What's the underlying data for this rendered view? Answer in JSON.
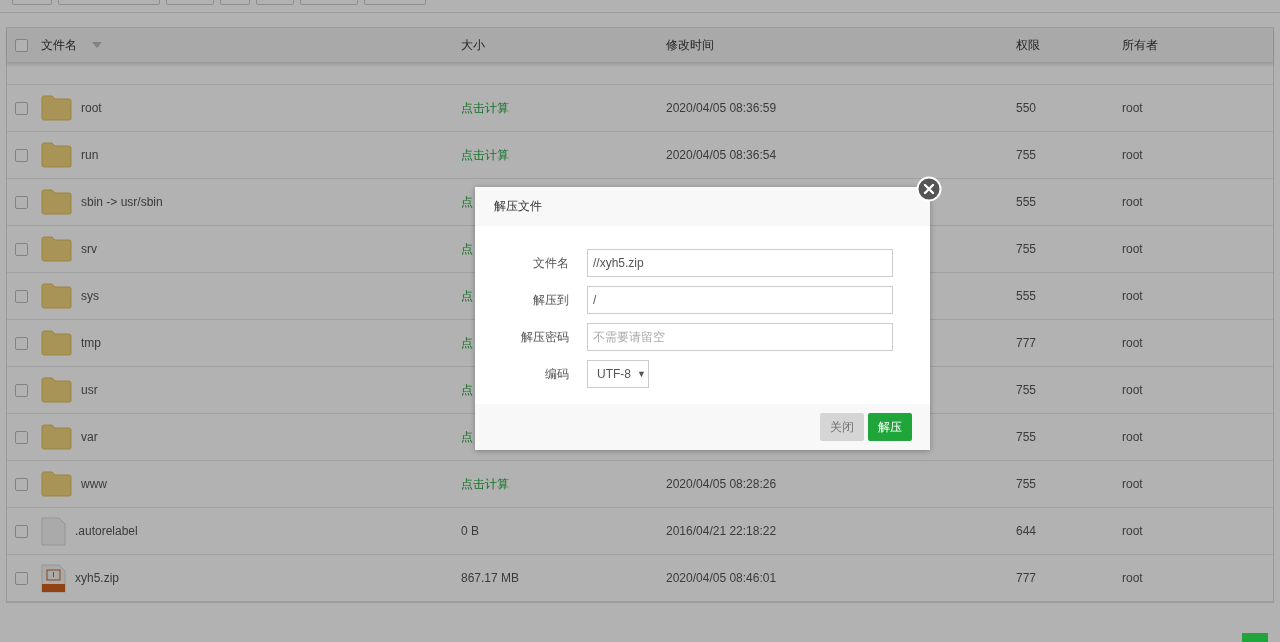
{
  "table": {
    "header_checkbox": {
      "checked": false
    },
    "columns": [
      {
        "label": "文件名",
        "sortable": true
      },
      {
        "label": "大小"
      },
      {
        "label": "修改时间"
      },
      {
        "label": "权限"
      },
      {
        "label": "所有者"
      }
    ],
    "rows": [
      {
        "kind": "folder",
        "checked": false,
        "name": "root",
        "size": "点击计算",
        "size_link": true,
        "time": "2020/04/05 08:36:59",
        "perm": "550",
        "owner": "root"
      },
      {
        "kind": "folder",
        "checked": false,
        "name": "run",
        "size": "点击计算",
        "size_link": true,
        "time": "2020/04/05 08:36:54",
        "perm": "755",
        "owner": "root"
      },
      {
        "kind": "folder",
        "checked": false,
        "name": "sbin -> usr/sbin",
        "size": "点",
        "size_link": true,
        "perm": "555",
        "owner": "root"
      },
      {
        "kind": "folder",
        "checked": false,
        "name": "srv",
        "size": "点",
        "size_link": true,
        "perm": "755",
        "owner": "root"
      },
      {
        "kind": "folder",
        "checked": false,
        "name": "sys",
        "size": "点",
        "size_link": true,
        "perm": "555",
        "owner": "root"
      },
      {
        "kind": "folder",
        "checked": false,
        "name": "tmp",
        "size": "点",
        "size_link": true,
        "perm": "777",
        "owner": "root"
      },
      {
        "kind": "folder",
        "checked": false,
        "name": "usr",
        "size": "点",
        "size_link": true,
        "perm": "755",
        "owner": "root"
      },
      {
        "kind": "folder",
        "checked": false,
        "name": "var",
        "size": "点",
        "size_link": true,
        "perm": "755",
        "owner": "root"
      },
      {
        "kind": "folder",
        "checked": false,
        "name": "www",
        "size": "点击计算",
        "size_link": true,
        "time": "2020/04/05 08:28:26",
        "perm": "755",
        "owner": "root"
      },
      {
        "kind": "file",
        "checked": false,
        "name": ".autorelabel",
        "size": "0 B",
        "size_link": false,
        "time": "2016/04/21 22:18:22",
        "perm": "644",
        "owner": "root"
      },
      {
        "kind": "zip",
        "checked": false,
        "name": "xyh5.zip",
        "size": "867.17 MB",
        "size_link": false,
        "time": "2020/04/05 08:46:01",
        "perm": "777",
        "owner": "root"
      }
    ]
  },
  "dialog": {
    "title": "解压文件",
    "fields": [
      {
        "kind": "text",
        "label": "文件名",
        "value": "//xyh5.zip"
      },
      {
        "kind": "text",
        "label": "解压到",
        "value": "/"
      },
      {
        "kind": "text",
        "label": "解压密码",
        "placeholder": "不需要请留空"
      },
      {
        "kind": "select",
        "label": "编码",
        "value": "UTF-8",
        "caret": "▼"
      }
    ],
    "buttons": [
      {
        "label": "关闭",
        "kind": "secondary"
      },
      {
        "label": "解压",
        "kind": "primary"
      }
    ]
  }
}
